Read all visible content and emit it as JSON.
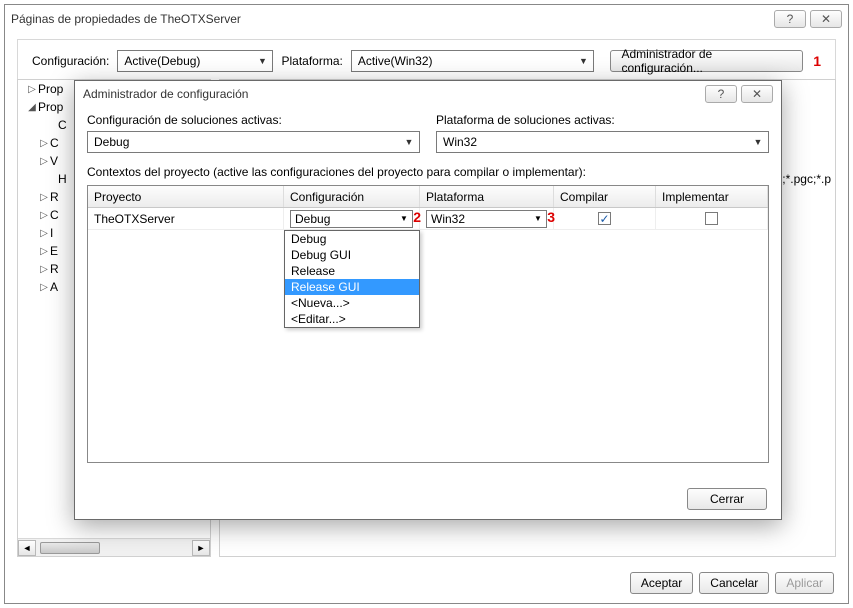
{
  "parent": {
    "title": "Páginas de propiedades de TheOTXServer",
    "config_label": "Configuración:",
    "config_value": "Active(Debug)",
    "platform_label": "Plataforma:",
    "platform_value": "Active(Win32)",
    "config_mgr_btn": "Administrador de configuración...",
    "marker1": "1",
    "tree": {
      "items": [
        "Prop",
        "Prop",
        "C",
        "C",
        "V",
        "H",
        "R",
        "C",
        "I",
        "E",
        "R",
        "A"
      ],
      "twisties": [
        "▷",
        "◢",
        "",
        "▷",
        "▷",
        "",
        "▷",
        "▷",
        "▷",
        "▷",
        "▷",
        "▷"
      ]
    },
    "right_peek": "p;*.pgc;*.p",
    "ok": "Aceptar",
    "cancel": "Cancelar",
    "apply": "Aplicar"
  },
  "modal": {
    "title": "Administrador de configuración",
    "sol_config_label": "Configuración de soluciones activas:",
    "sol_config_value": "Debug",
    "sol_plat_label": "Plataforma de soluciones activas:",
    "sol_plat_value": "Win32",
    "ctx_label": "Contextos del proyecto (active las configuraciones del proyecto para compilar o implementar):",
    "headers": {
      "project": "Proyecto",
      "config": "Configuración",
      "platform": "Plataforma",
      "build": "Compilar",
      "deploy": "Implementar"
    },
    "row": {
      "project": "TheOTXServer",
      "config": "Debug",
      "platform": "Win32",
      "build_checked": "✓",
      "deploy_checked": "",
      "marker2": "2",
      "marker3": "3"
    },
    "dropdown": [
      "Debug",
      "Debug GUI",
      "Release",
      "Release GUI",
      "<Nueva...>",
      "<Editar...>"
    ],
    "dropdown_selected_index": 3,
    "close": "Cerrar"
  },
  "glyphs": {
    "help": "?",
    "close": "✕",
    "down": "▼",
    "left": "◄",
    "right": "►"
  }
}
